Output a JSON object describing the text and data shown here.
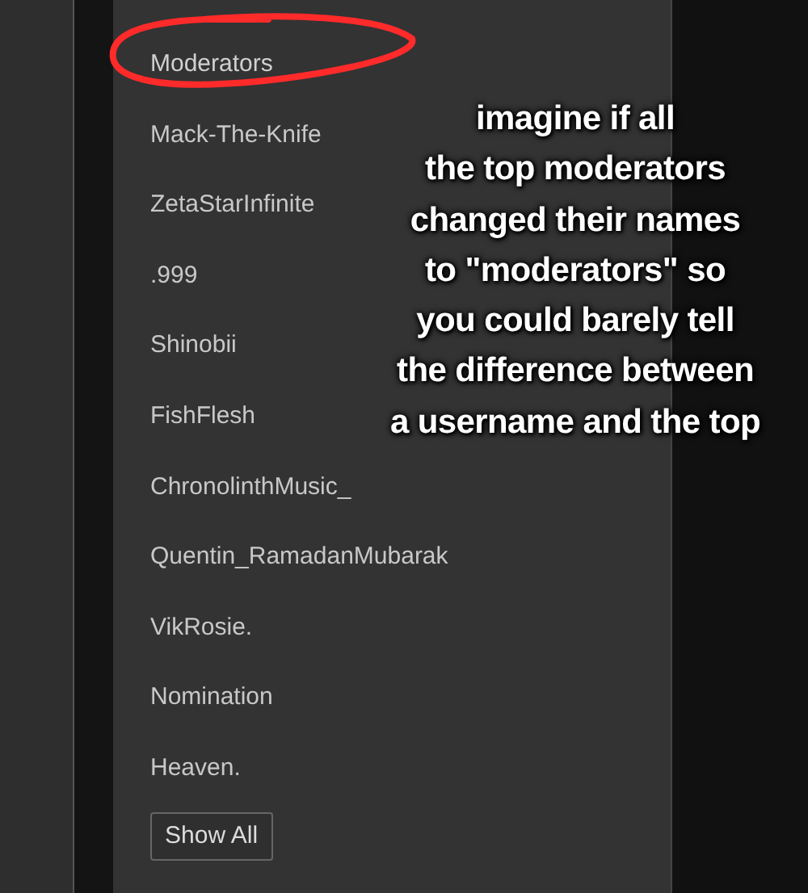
{
  "panel": {
    "heading": {
      "text": "Moderators",
      "circled": true
    },
    "moderators": [
      "Mack-The-Knife",
      "ZetaStarInfinite",
      ".999",
      "Shinobii",
      "FishFlesh",
      "ChronolinthMusic_",
      "Quentin_RamadanMubarak",
      "VikRosie.",
      "Nomination",
      "Heaven."
    ],
    "button": "Show All"
  },
  "caption": {
    "lines": [
      "imagine if all",
      "the top moderators",
      "changed their names",
      "to \"moderators\" so",
      "you could barely tell",
      "the difference between",
      "a username and the top"
    ]
  }
}
